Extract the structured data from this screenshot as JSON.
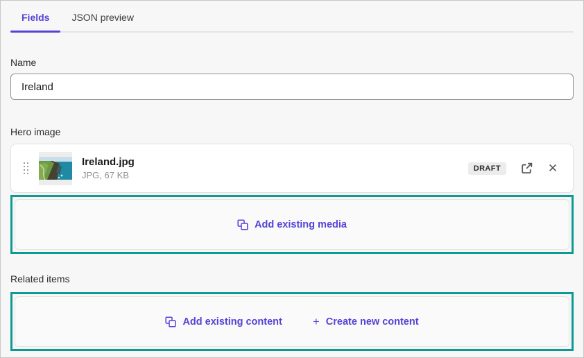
{
  "tabs": {
    "fields": "Fields",
    "json_preview": "JSON preview"
  },
  "name_field": {
    "label": "Name",
    "value": "Ireland"
  },
  "hero_image": {
    "label": "Hero image",
    "media_item": {
      "filename": "Ireland.jpg",
      "meta": "JPG, 67 KB",
      "status": "DRAFT"
    },
    "add_button": "Add existing media"
  },
  "related_items": {
    "label": "Related items",
    "add_existing_button": "Add existing content",
    "create_new_button": "Create new content"
  },
  "icons": {
    "close": "✕",
    "plus": "+"
  },
  "colors": {
    "accent_purple": "#5442d6",
    "highlight_teal": "#0c9a92",
    "badge_bg": "#ececec"
  }
}
